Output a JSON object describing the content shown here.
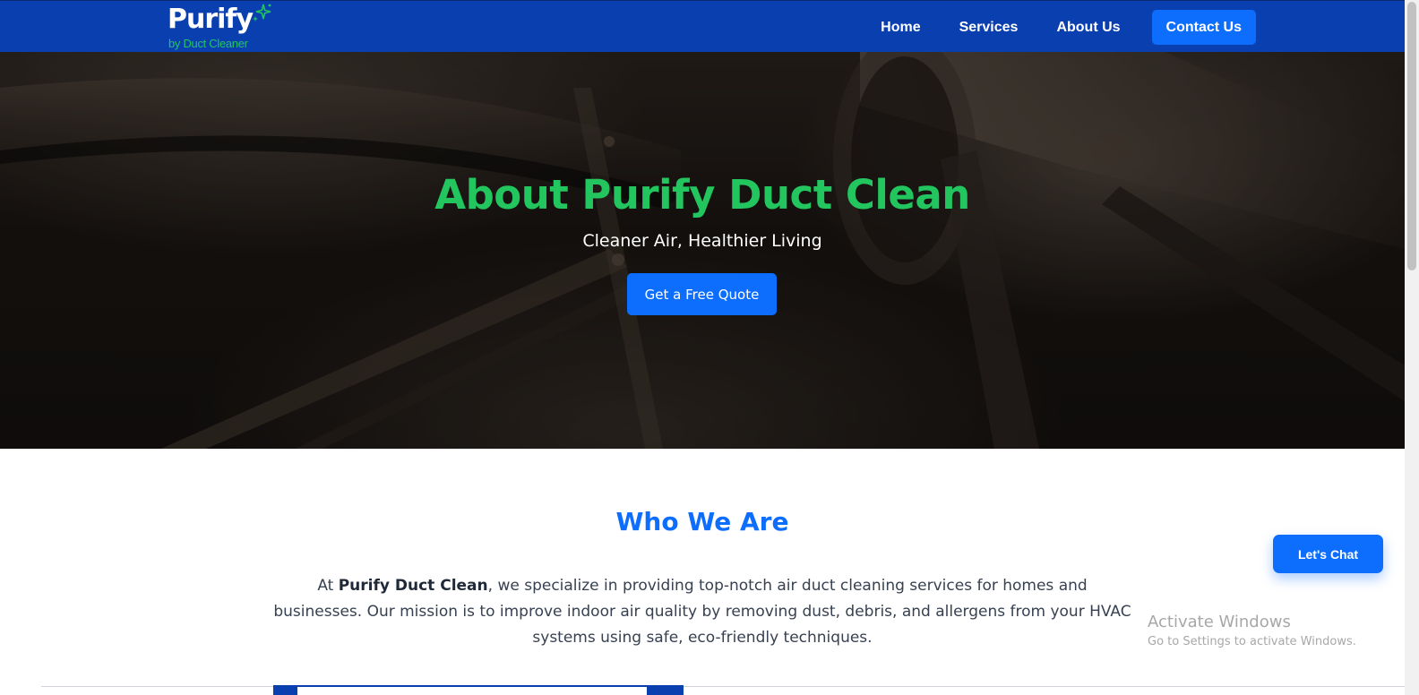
{
  "brand": {
    "name": "Purify",
    "tagline": "by Duct Cleaner",
    "logo_icon": "sparkle-icon",
    "colors": {
      "nav": "#0a3fb0",
      "accent": "#0d6efd",
      "green": "#22c55e"
    }
  },
  "nav": {
    "items": [
      {
        "label": "Home"
      },
      {
        "label": "Services"
      },
      {
        "label": "About Us"
      }
    ],
    "contact_label": "Contact Us"
  },
  "hero": {
    "title": "About Purify Duct Clean",
    "subtitle": "Cleaner Air, Healthier Living",
    "cta_label": "Get a Free Quote"
  },
  "about": {
    "title": "Who We Are",
    "body_prefix": "At ",
    "body_strong": "Purify Duct Clean",
    "body_rest": ", we specialize in providing top-notch air duct cleaning services for homes and businesses. Our mission is to improve indoor air quality by removing dust, debris, and allergens from your HVAC systems using safe, eco-friendly techniques."
  },
  "chat": {
    "label": "Let's Chat"
  },
  "watermark": {
    "title": "Activate Windows",
    "subtitle": "Go to Settings to activate Windows."
  }
}
